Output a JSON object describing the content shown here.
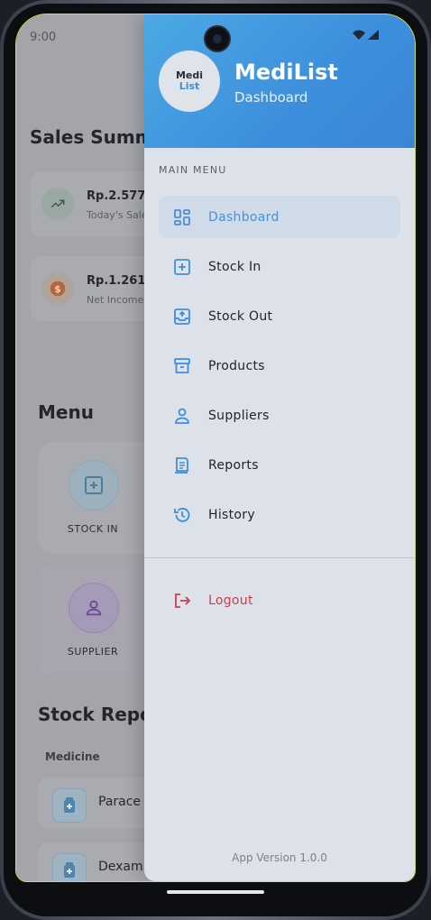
{
  "status_bar": {
    "time": "9:00"
  },
  "background": {
    "sales_title": "Sales Summ",
    "cards": [
      {
        "amount": "Rp.2.577.",
        "caption": "Today's Sale",
        "icon": "trending-up-icon"
      },
      {
        "amount": "Rp.1.261.7",
        "caption": "Net Income",
        "icon": "dollar-icon"
      }
    ],
    "menu_title": "Menu",
    "tiles": [
      {
        "label": "STOCK IN",
        "icon": "add-box-icon"
      },
      {
        "label": "SUPPLIER",
        "icon": "person-icon"
      }
    ],
    "stock_title": "Stock Repor",
    "table_header": "Medicine",
    "rows": [
      {
        "name": "Parace"
      },
      {
        "name": "Dexam"
      }
    ]
  },
  "drawer": {
    "logo_line1": "Medi",
    "logo_line2": "List",
    "title": "MediList",
    "subtitle": "Dashboard",
    "section_label": "MAIN MENU",
    "items": [
      {
        "label": "Dashboard",
        "icon": "dashboard-icon",
        "active": true
      },
      {
        "label": "Stock In",
        "icon": "add-box-icon"
      },
      {
        "label": "Stock Out",
        "icon": "inbox-out-icon"
      },
      {
        "label": "Products",
        "icon": "archive-icon"
      },
      {
        "label": "Suppliers",
        "icon": "person-icon"
      },
      {
        "label": "Reports",
        "icon": "report-icon"
      },
      {
        "label": "History",
        "icon": "history-icon"
      }
    ],
    "logout_label": "Logout",
    "version": "App Version 1.0.0"
  },
  "colors": {
    "accent": "#3d8fdc",
    "active_bg": "#cfdbe9",
    "logout": "#c9404c"
  }
}
